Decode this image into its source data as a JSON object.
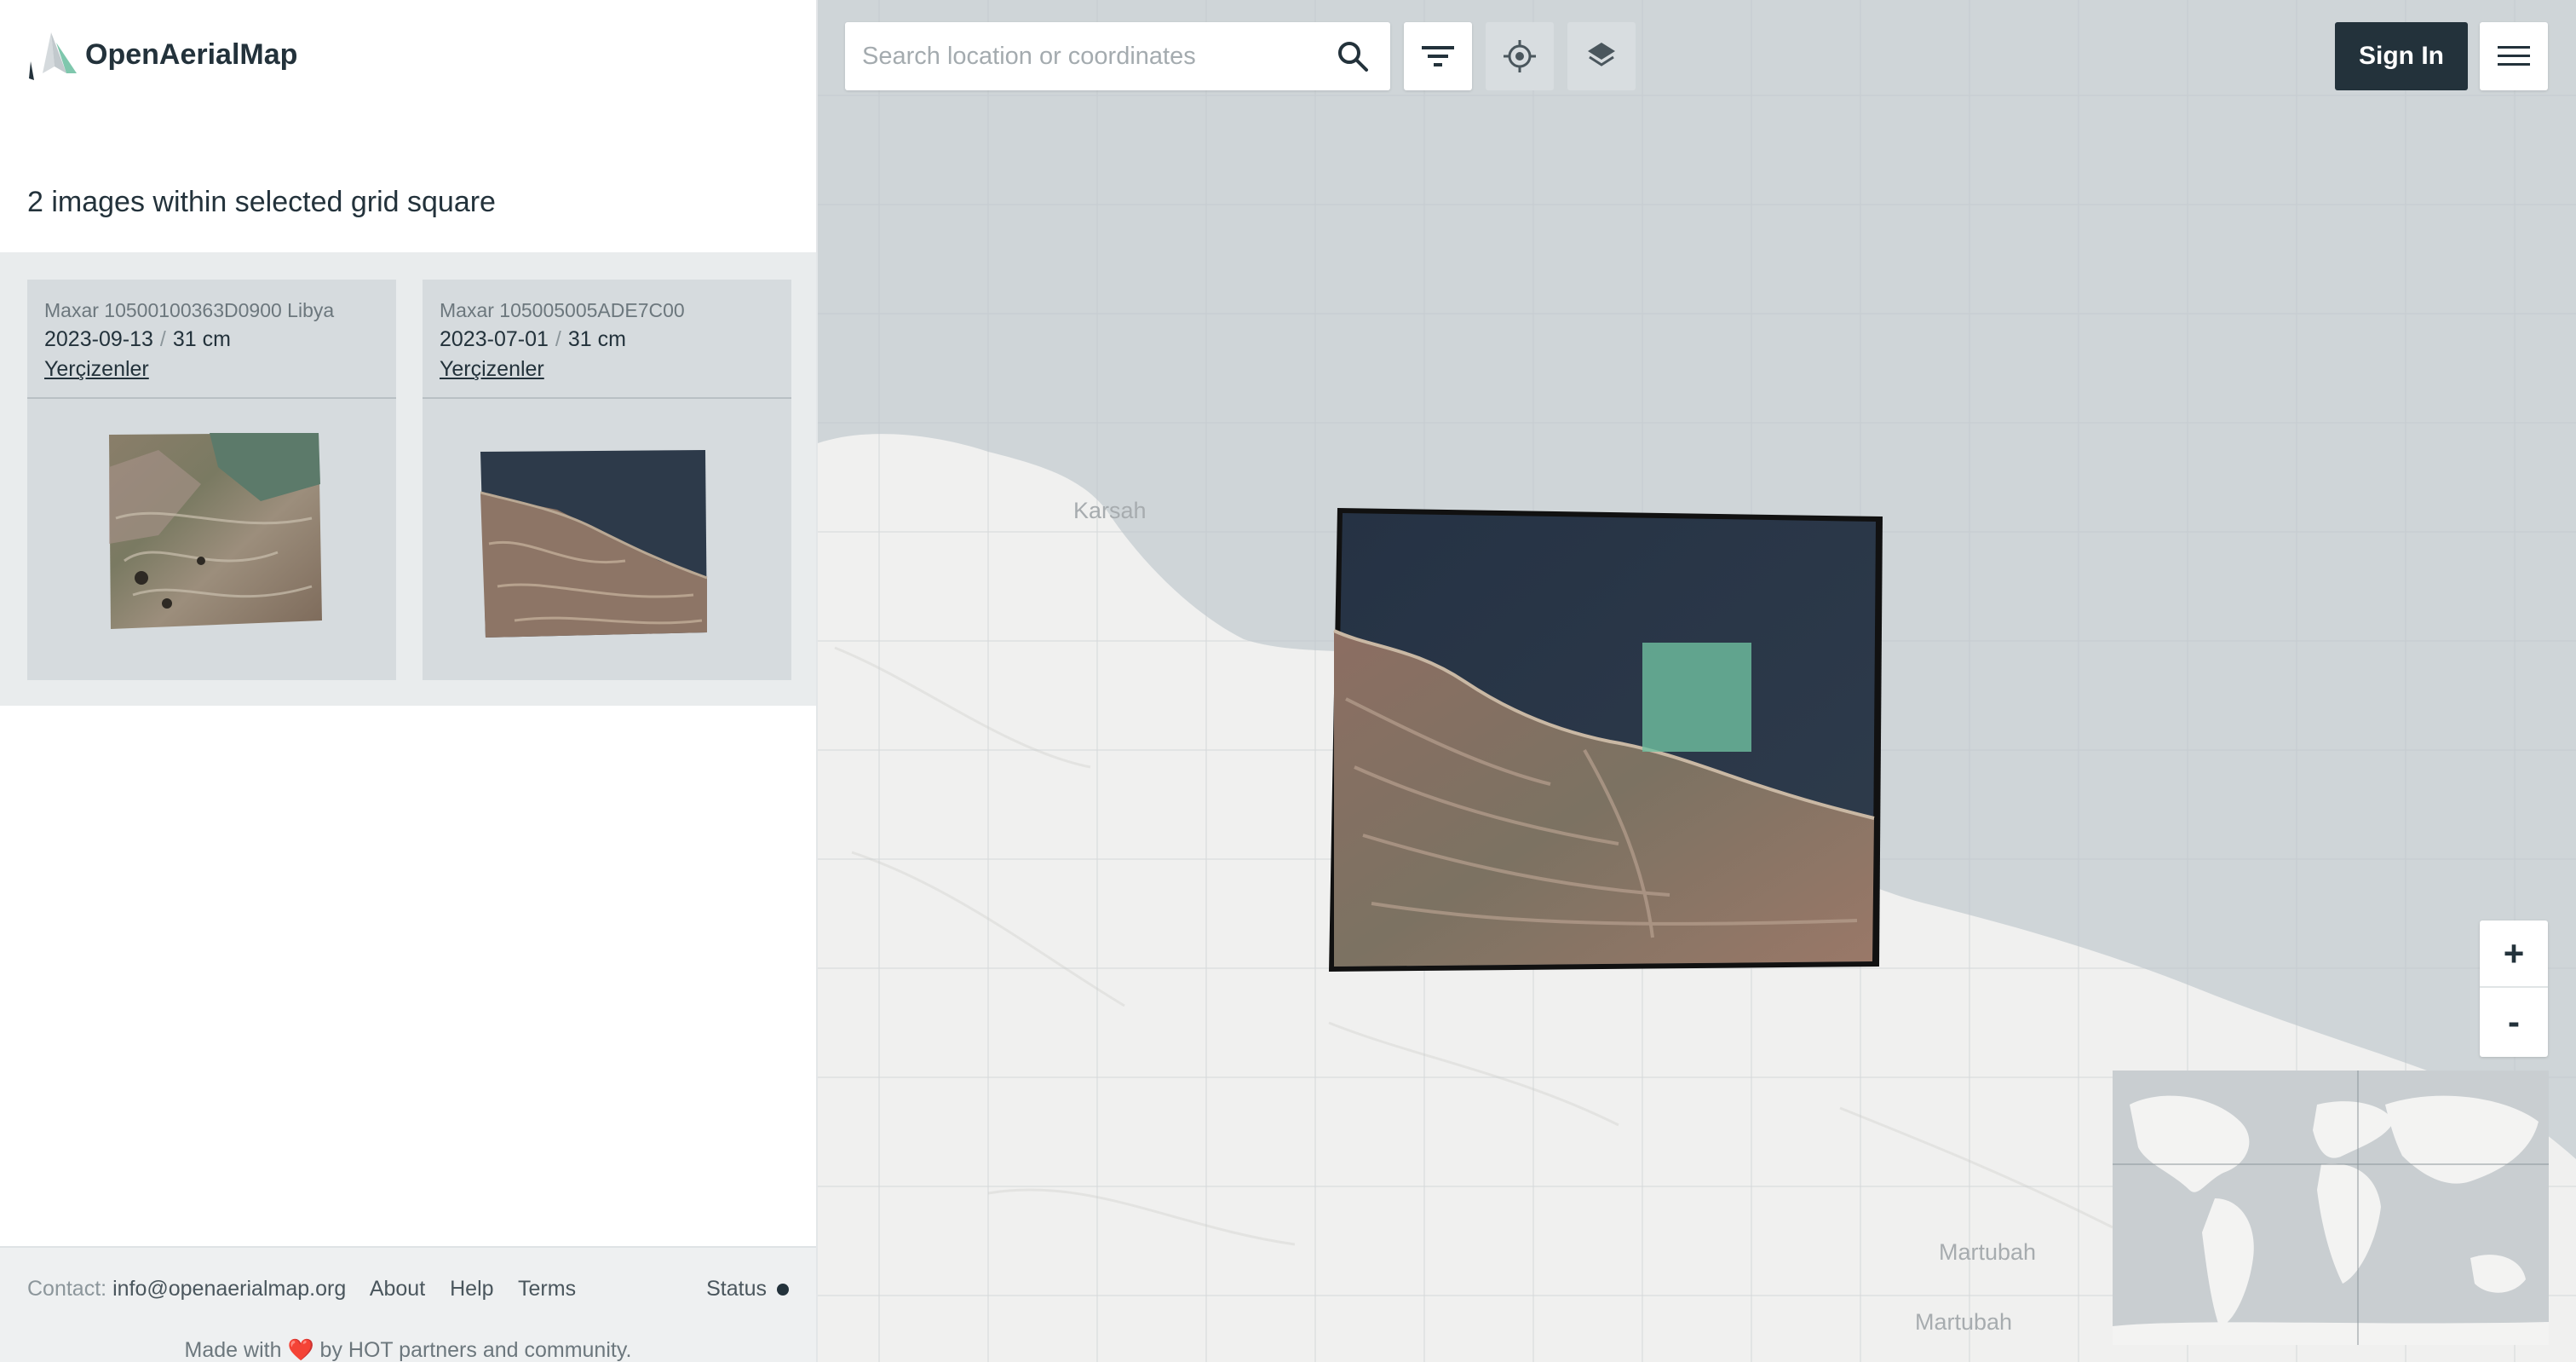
{
  "brand": {
    "name": "OpenAerialMap",
    "icon": "oam-logo-icon"
  },
  "results": {
    "title": "2 images within selected grid square",
    "cards": [
      {
        "title": "Maxar 10500100363D0900 Libya",
        "date": "2023-09-13",
        "separator": "/",
        "resolution": "31 cm",
        "provider": "Yerçizenler"
      },
      {
        "title": "Maxar 105005005ADE7C00",
        "date": "2023-07-01",
        "separator": "/",
        "resolution": "31 cm",
        "provider": "Yerçizenler"
      }
    ]
  },
  "footer": {
    "contact_label": "Contact:",
    "contact_email": "info@openaerialmap.org",
    "links": [
      "About",
      "Help",
      "Terms"
    ],
    "status_label": "Status",
    "made_prefix": "Made with",
    "heart": "❤️",
    "made_suffix": "by HOT partners and community."
  },
  "map": {
    "search": {
      "placeholder": "Search location or coordinates",
      "value": "",
      "icon": "search-icon"
    },
    "toolbar": {
      "filter_icon": "filter-icon",
      "locate_icon": "crosshair-icon",
      "layers_icon": "layers-icon"
    },
    "sign_in_label": "Sign In",
    "menu_icon": "hamburger-menu-icon",
    "zoom_in_label": "+",
    "zoom_out_label": "-",
    "place_labels": [
      "Karsah",
      "Martubah",
      "Martubah"
    ]
  },
  "colors": {
    "primary": "#23323b",
    "sea": "#cfd5d8",
    "land": "#f0f0ef",
    "selected_cell": "#6fbfa0",
    "heart": "#e0342f"
  }
}
